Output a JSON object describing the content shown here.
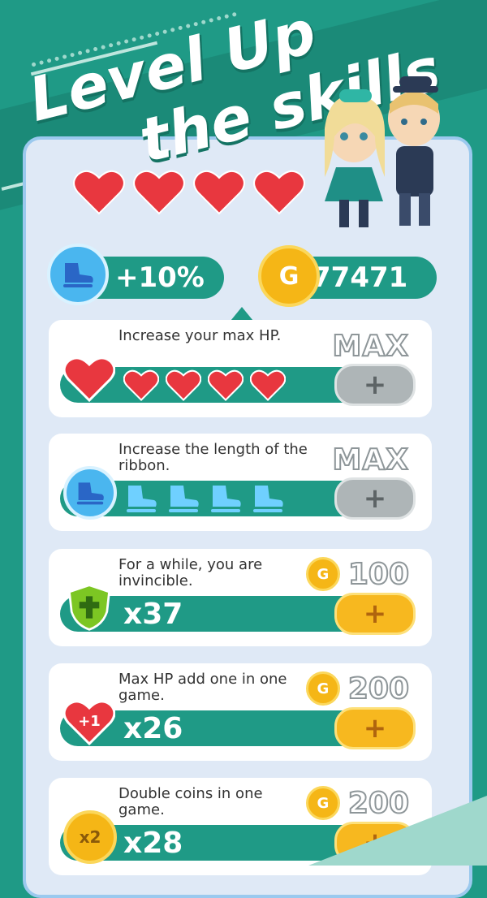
{
  "banner": {
    "title_line1": "Level Up",
    "title_line2": "the skills"
  },
  "hp_hearts": 4,
  "stats": {
    "bonus": "+10%",
    "coins": "77471",
    "coin_symbol": "G"
  },
  "skills": [
    {
      "desc": "Increase your max HP.",
      "status": "MAX",
      "level_icons": 4,
      "icon": "heart-icon"
    },
    {
      "desc": "Increase the length of the ribbon.",
      "status": "MAX",
      "level_icons": 4,
      "icon": "skate-icon"
    },
    {
      "desc": "For a while, you are invincible.",
      "price": "100",
      "count": "x37",
      "icon": "shield-cross-icon"
    },
    {
      "desc": "Max HP add one in one game.",
      "price": "200",
      "count": "x26",
      "icon": "heart-plus-one-icon",
      "icon_text": "+1"
    },
    {
      "desc": "Double coins in one game.",
      "price": "200",
      "count": "x28",
      "icon": "coin-x2-icon",
      "icon_text": "x2"
    }
  ],
  "colors": {
    "teal": "#1f9a86",
    "panel": "#dfe9f6",
    "gold": "#f7b81f",
    "heart": "#e8373f"
  }
}
